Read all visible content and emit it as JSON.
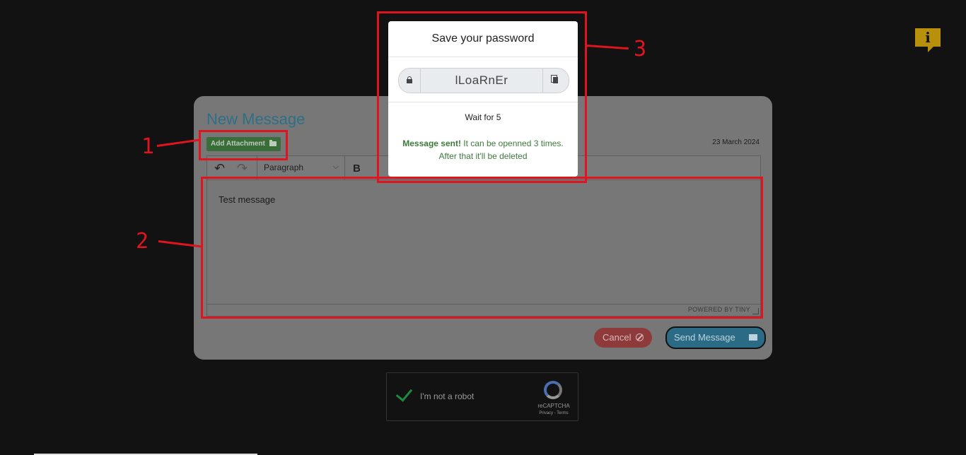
{
  "info_badge": {
    "glyph": "i",
    "icon": "info-icon",
    "color": "#b8900c"
  },
  "compose": {
    "title": "New Message",
    "attach_label": "Add Attachment",
    "date": "23 March 2024",
    "toolbar": {
      "undo_glyph": "↶",
      "redo_glyph": "↷",
      "format_value": "Paragraph",
      "chevron_glyph": "⌵",
      "bold_label": "B"
    },
    "editor": {
      "content": "Test message",
      "powered_by": "POWERED BY TINY"
    },
    "cancel_label": "Cancel",
    "send_label": "Send Message",
    "colors": {
      "title": "#2f6f86",
      "attach": "#3a6d3a",
      "cancel": "#8e3a3a",
      "send": "#2c6b86"
    }
  },
  "captcha": {
    "label": "I'm not a robot",
    "brand": "reCAPTCHA",
    "links": "Privacy - Terms"
  },
  "modal": {
    "title": "Save your password",
    "password": "lLoaRnEr",
    "wait_text": "Wait for 5",
    "sent_strong": "Message sent!",
    "sent_rest": " It can be openned 3 times. After that it'll be deleted",
    "sent_color": "#3c7a3c"
  },
  "annotations": {
    "color": "#e0141e",
    "labels": [
      "1",
      "2",
      "3"
    ]
  }
}
